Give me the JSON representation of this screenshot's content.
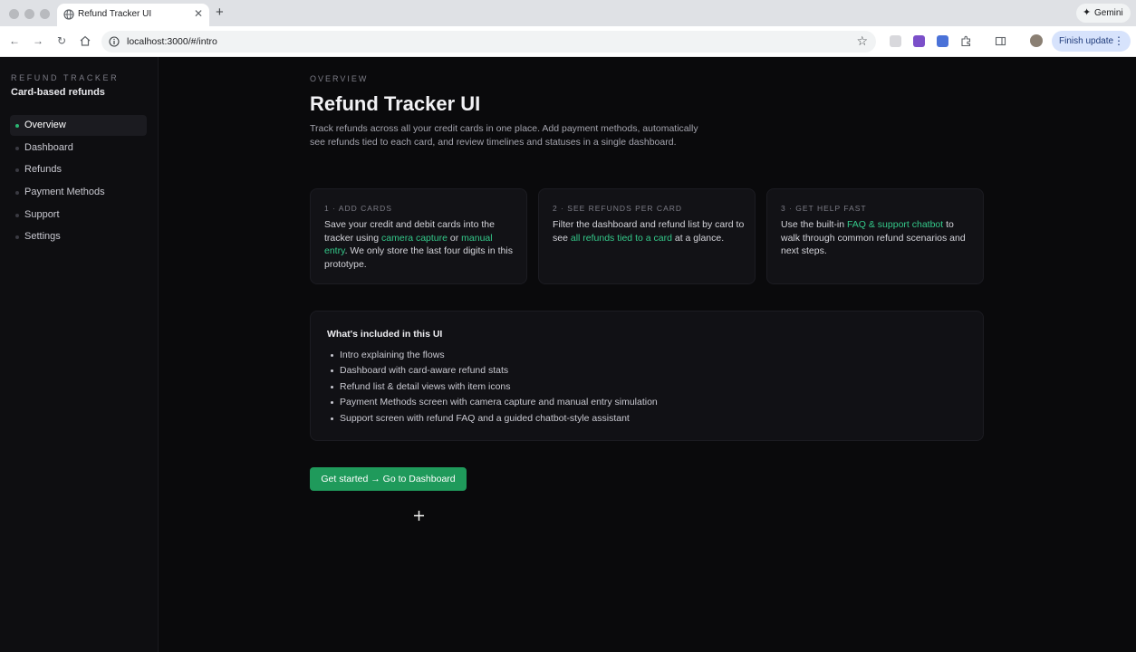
{
  "browser": {
    "tab_title": "Refund Tracker UI",
    "new_tab_glyph": "+",
    "close_glyph": "✕",
    "url": "localhost:3000/#/intro",
    "gemini_label": "Gemini",
    "finish_update_label": "Finish update"
  },
  "sidebar": {
    "eyebrow": "REFUND TRACKER",
    "title": "Card-based refunds",
    "items": [
      {
        "label": "Overview",
        "active": true
      },
      {
        "label": "Dashboard",
        "active": false
      },
      {
        "label": "Refunds",
        "active": false
      },
      {
        "label": "Payment Methods",
        "active": false
      },
      {
        "label": "Support",
        "active": false
      },
      {
        "label": "Settings",
        "active": false
      }
    ]
  },
  "main": {
    "eyebrow": "OVERVIEW",
    "title": "Refund Tracker UI",
    "description": "Track refunds across all your credit cards in one place. Add payment methods, automatically see refunds tied to each card, and review timelines and statuses in a single dashboard.",
    "steps": [
      {
        "title": "1 · ADD CARDS",
        "text_a": "Save your credit and debit cards into the tracker using ",
        "link_a": "camera capture",
        "text_b": " or ",
        "link_b": "manual entry",
        "text_c": ". We only store the last four digits in this prototype."
      },
      {
        "title": "2 · SEE REFUNDS PER CARD",
        "text_a": "Filter the dashboard and refund list by card to see ",
        "link_a": "all refunds tied to a card",
        "text_b": " at a glance."
      },
      {
        "title": "3 · GET HELP FAST",
        "text_a": "Use the built-in ",
        "link_a": "FAQ & support chatbot",
        "text_b": " to walk through common refund scenarios and next steps."
      }
    ],
    "included": {
      "title": "What's included in this UI",
      "items": [
        "Intro explaining the flows",
        "Dashboard with card-aware refund stats",
        "Refund list & detail views with item icons",
        "Payment Methods screen with camera capture and manual entry simulation",
        "Support screen with refund FAQ and a guided chatbot-style assistant"
      ]
    },
    "cta_label": "Get started → Go to Dashboard"
  },
  "colors": {
    "accent": "#34c98a",
    "button": "#1f9a5b",
    "background": "#0a0a0c"
  }
}
